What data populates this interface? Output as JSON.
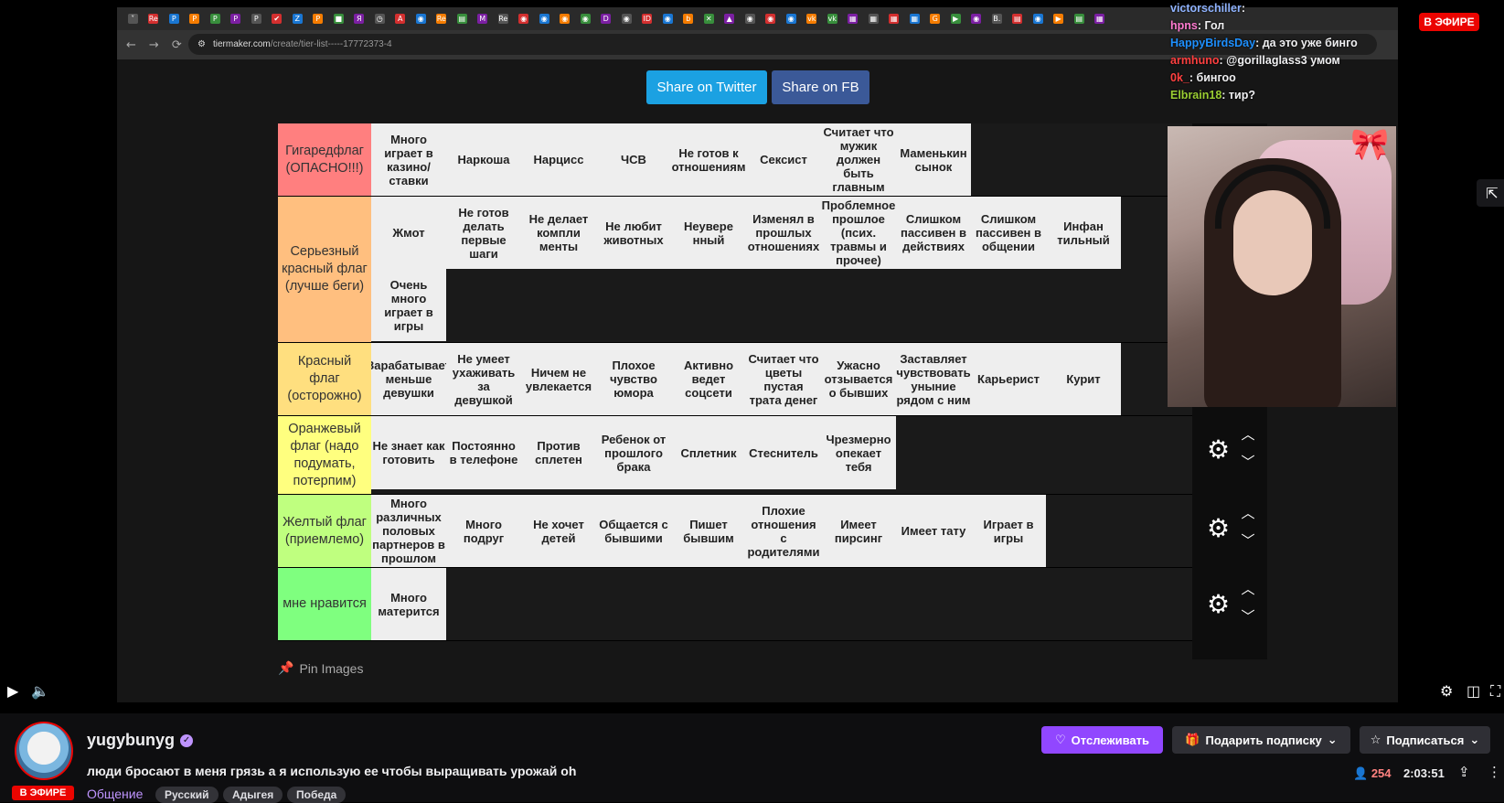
{
  "browser": {
    "url_domain": "tiermaker.com",
    "url_path": "/create/tier-list-----17772373-4",
    "tabs": [
      "˅",
      "Re",
      "P",
      "P",
      "P",
      "P",
      "P",
      "✔",
      "Z",
      "P",
      "■",
      "Я",
      "◷",
      "A",
      "◉",
      "Re",
      "▤",
      "M",
      "Re",
      "◉",
      "◉",
      "◉",
      "◉",
      "D",
      "◉",
      "ID",
      "◉",
      "b",
      "✕",
      "▲",
      "◉",
      "◉",
      "◉",
      "vk",
      "vk",
      "▦",
      "▦",
      "▦",
      "▦",
      "G",
      "▶",
      "◉",
      "B.",
      "▤",
      "◉",
      "▶",
      "▤",
      "▦"
    ]
  },
  "page": {
    "share_twitter": "Share on Twitter",
    "share_fb": "Share on FB",
    "pin_images": "Pin Images"
  },
  "tiers": [
    {
      "label": "Гигаредфлаг (ОПАСНО!!!)",
      "color": "#ff7f7f",
      "items": [
        "Много играет в казино/ставки",
        "Наркоша",
        "Нарцисс",
        "ЧСВ",
        "Не готов к отношениям",
        "Сексист",
        "Считает что мужик должен быть главным",
        "Маменькин сынок"
      ]
    },
    {
      "label": "Серьезный красный флаг (лучше беги)",
      "color": "#ffbf7f",
      "items": [
        "Жмот",
        "Не готов делать первые шаги",
        "Не делает компли менты",
        "Не любит животных",
        "Неувере нный",
        "Изменял в прошлых отношениях",
        "Проблемное прошлое (псих. травмы и прочее)",
        "Слишком пассивен в действиях",
        "Слишком пассивен в общении",
        "Инфан тильный",
        "Очень много играет в игры"
      ]
    },
    {
      "label": "Красный флаг (осторожно)",
      "color": "#ffdf7f",
      "items": [
        "Зарабатывает меньше девушки",
        "Не умеет ухаживать за девушкой",
        "Ничем не увлекается",
        "Плохое чувство юмора",
        "Активно ведет соцсети",
        "Считает что цветы пустая трата денег",
        "Ужасно отзывается о бывших",
        "Заставляет чувствовать уныние рядом с ним",
        "Карьерист",
        "Курит"
      ]
    },
    {
      "label": "Оранжевый флаг (надо подумать, потерпим)",
      "color": "#ffff7f",
      "items": [
        "Не знает как готовить",
        "Постоянно в телефоне",
        "Против сплетен",
        "Ребенок от прошлого брака",
        "Сплетник",
        "Стеснитель",
        "Чрезмерно опекает тебя"
      ]
    },
    {
      "label": "Желтый флаг (приемлемо)",
      "color": "#bfff7f",
      "items": [
        "Много различных половых партнеров в прошлом",
        "Много подруг",
        "Не хочет детей",
        "Общается с бывшими",
        "Пишет бывшим",
        "Плохие отношения с родителями",
        "Имеет пирсинг",
        "Имеет тату",
        "Играет в игры"
      ]
    },
    {
      "label": "мне нравится",
      "color": "#7fff7f",
      "items": [
        "Много матерится"
      ]
    }
  ],
  "chat": [
    {
      "user": "victorschiller",
      "color": "#8fb3ff",
      "text": ""
    },
    {
      "user": "hpns",
      "color": "#ff7bd0",
      "text": "Гол"
    },
    {
      "user": "HappyBirdsDay",
      "color": "#1e90ff",
      "text": "да это уже бинго"
    },
    {
      "user": "armhuno",
      "color": "#ff4040",
      "text": "@gorillaglass3 умом"
    },
    {
      "user": "0k_",
      "color": "#ff4040",
      "text": "бингоо"
    },
    {
      "user": "Elbrain18",
      "color": "#9acd32",
      "text": "тир?"
    }
  ],
  "stream": {
    "live_label": "В ЭФИРЕ",
    "channel": "yugybunyg",
    "title": "люди бросают в меня грязь а я использую ее чтобы выращивать урожай oh",
    "category": "Общение",
    "tags": [
      "Русский",
      "Адыгея",
      "Победа"
    ],
    "follow": "Отслеживать",
    "gift_sub": "Подарить подписку",
    "subscribe": "Подписаться",
    "viewers": "254",
    "uptime": "2:03:51"
  },
  "colors": {
    "accent": "#9147ff",
    "live": "#eb0400"
  }
}
